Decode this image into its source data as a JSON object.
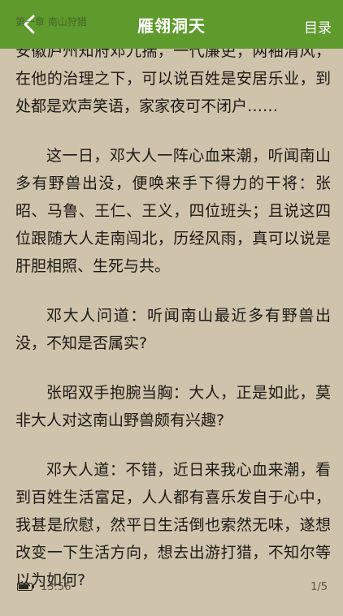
{
  "header": {
    "title": "雁翎洞天",
    "toc_label": "目录",
    "back_icon": "chevron-left-icon",
    "accent": "#5e9a2c"
  },
  "chapter_tag": "第一章 南山狩猎",
  "paragraphs": [
    "安徽庐州知府邓九揣，一代廉吏，两袖清风，在他的治理之下，可以说百姓是安居乐业，到处都是欢声笑语，家家夜可不闭户……",
    "这一日，邓大人一阵心血来潮，听闻南山多有野兽出没，便唤来手下得力的干将：张昭、马鲁、王仁、王义，四位班头；且说这四位跟随大人走南闯北，历经风雨，真可以说是肝胆相照、生死与共。",
    "邓大人问道：听闻南山最近多有野兽出没，不知是否属实?",
    "张昭双手抱腕当胸：大人，正是如此，莫非大人对这南山野兽颇有兴趣?",
    "邓大人道：不错，近日来我心血来潮，看到百姓生活富足，人人都有喜乐发自于心中，我甚是欣慰，然平日生活倒也索然无味，遂想改变一下生活方向，想去出游打猎，不知尔等以为如何?"
  ],
  "footer": {
    "battery_level": 0.8,
    "time": "13:56",
    "page_indicator": "1/5"
  }
}
